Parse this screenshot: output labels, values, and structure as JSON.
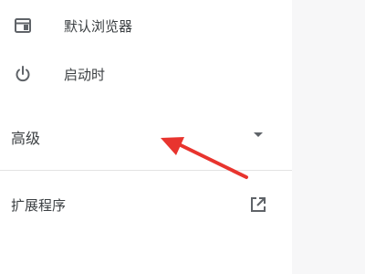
{
  "menu": {
    "default_browser_label": "默认浏览器",
    "default_browser_icon": "browser-window-icon",
    "on_startup_label": "启动时",
    "on_startup_icon": "power-icon"
  },
  "advanced": {
    "label": "高级",
    "caret_icon": "dropdown-caret-icon"
  },
  "extensions": {
    "label": "扩展程序",
    "icon": "open-in-new-icon"
  },
  "annotation": {
    "color": "#e8342e",
    "icon": "red-arrow-annotation"
  }
}
